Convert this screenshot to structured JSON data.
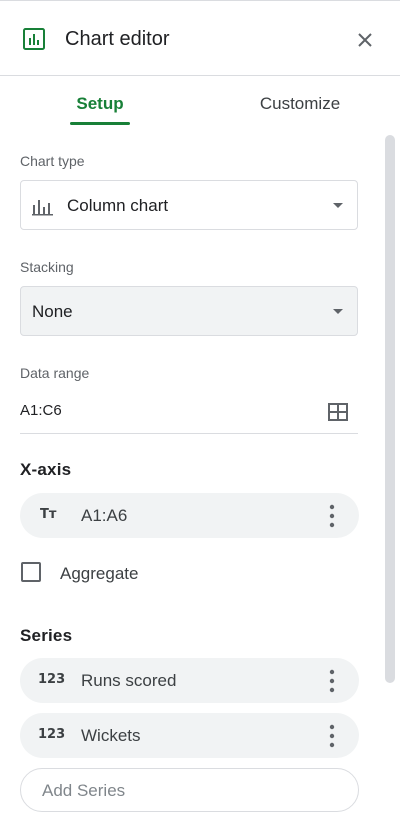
{
  "header": {
    "title": "Chart editor",
    "logo_icon": "chart-editor-icon",
    "close_icon": "close-icon",
    "accent_color": "#188038"
  },
  "tabs": [
    {
      "label": "Setup",
      "active": true
    },
    {
      "label": "Customize",
      "active": false
    }
  ],
  "chart_type": {
    "label": "Chart type",
    "value": "Column chart",
    "icon": "column-chart-icon"
  },
  "stacking": {
    "label": "Stacking",
    "value": "None"
  },
  "data_range": {
    "label": "Data range",
    "value": "A1:C6",
    "icon": "grid-select-icon"
  },
  "x_axis": {
    "heading": "X-axis",
    "chip": {
      "icon": "Tт",
      "label": "A1:A6"
    }
  },
  "aggregate": {
    "label": "Aggregate",
    "checked": false
  },
  "series": {
    "heading": "Series",
    "items": [
      {
        "icon": "123",
        "label": "Runs scored"
      },
      {
        "icon": "123",
        "label": "Wickets"
      }
    ],
    "add_placeholder": "Add Series"
  }
}
